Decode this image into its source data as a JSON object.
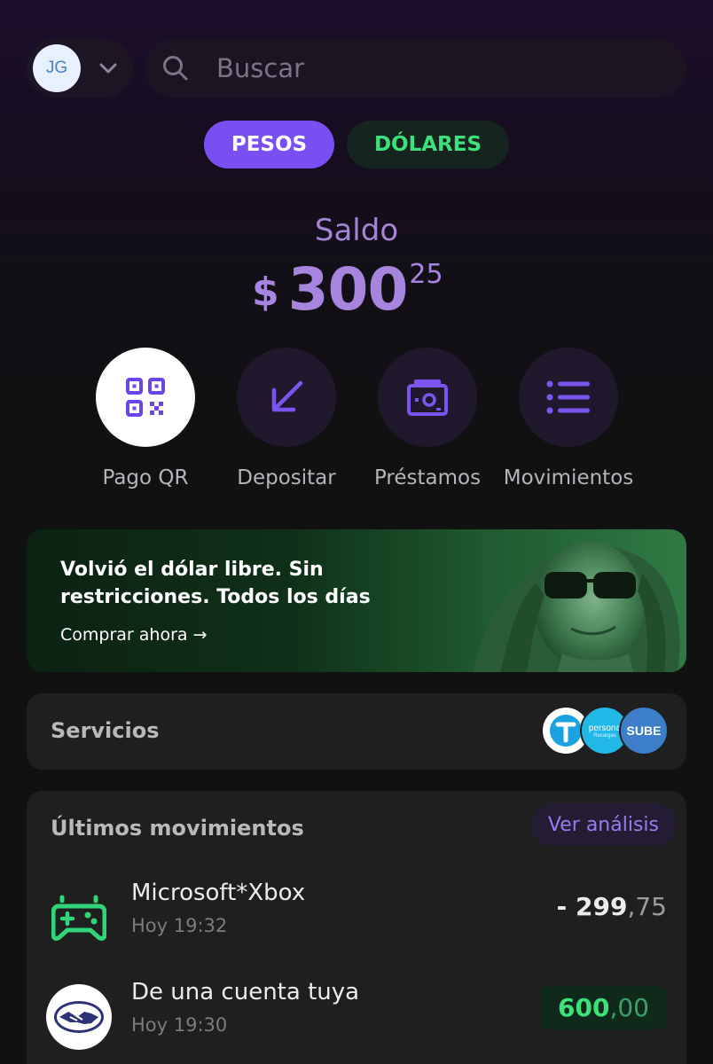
{
  "header": {
    "avatar_initials": "JG",
    "search_placeholder": "Buscar"
  },
  "currency_tabs": [
    {
      "label": "PESOS",
      "selected": true
    },
    {
      "label": "DÓLARES",
      "selected": false
    }
  ],
  "balance": {
    "label": "Saldo",
    "currency_symbol": "$",
    "integer": "300",
    "decimals": "25"
  },
  "actions": [
    {
      "label": "Pago QR",
      "icon": "qr-code-icon"
    },
    {
      "label": "Depositar",
      "icon": "arrow-down-left-icon"
    },
    {
      "label": "Préstamos",
      "icon": "loan-icon"
    },
    {
      "label": "Movimientos",
      "icon": "list-icon"
    }
  ],
  "promo": {
    "title": "Volvió el dólar libre. Sin restricciones. Todos los días",
    "cta": "Comprar ahora →"
  },
  "services": {
    "label": "Servicios",
    "logos": [
      "T",
      "persona",
      "Recargas",
      "SUBE"
    ]
  },
  "movements": {
    "title": "Últimos movimientos",
    "analysis_button": "Ver análisis",
    "items": [
      {
        "name": "Microsoft*Xbox",
        "time": "Hoy 19:32",
        "amount_int": "- 299",
        "amount_dec": ",75",
        "positive": false,
        "icon": "gamepad-icon"
      },
      {
        "name": "De una cuenta tuya",
        "time": "Hoy 19:30",
        "amount_int": "600",
        "amount_dec": ",00",
        "positive": true,
        "icon": "handshake-icon"
      }
    ]
  },
  "colors": {
    "accent_purple": "#7a4ff2",
    "positive_green": "#3de07a",
    "background": "#111111"
  }
}
